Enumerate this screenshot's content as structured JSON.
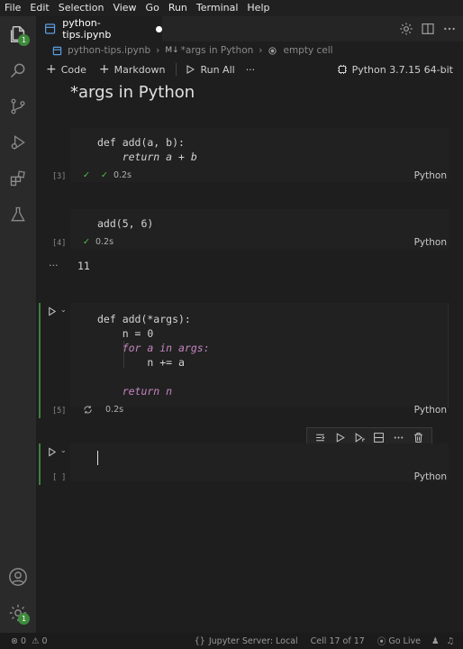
{
  "menu": [
    "File",
    "Edit",
    "Selection",
    "View",
    "Go",
    "Run",
    "Terminal",
    "Help"
  ],
  "tab": {
    "title": "python-tips.ipynb"
  },
  "breadcrumb": {
    "file": "python-tips.ipynb",
    "md_marker": "M↓",
    "section": "*args in Python",
    "cell": "empty cell"
  },
  "toolbar": {
    "code": "Code",
    "markdown": "Markdown",
    "run_all": "Run All",
    "more": "···",
    "kernel": "Python 3.7.15 64-bit"
  },
  "activity": {
    "explorer_badge": "1",
    "settings_badge": "1"
  },
  "heading": "*args in Python",
  "cells": [
    {
      "exec": "[3]",
      "time": "0.2s",
      "lang": "Python",
      "lines": [
        "def add(a, b):",
        "    return a + b"
      ]
    },
    {
      "exec": "[4]",
      "time": "0.2s",
      "lang": "Python",
      "lines": [
        "add(5, 6)"
      ],
      "output_more": "···",
      "output": "11"
    },
    {
      "exec": "[5]",
      "time": "0.2s",
      "lang": "Python",
      "lines": [
        "def add(*args):",
        "    n = 0",
        "    for a in args:",
        "        n += a",
        "",
        "    return n"
      ]
    },
    {
      "exec": "[ ]",
      "lang": "Python"
    }
  ],
  "statusbar": {
    "errors": "0",
    "warnings": "0",
    "jupyter": "Jupyter Server: Local",
    "cell": "Cell 17 of 17",
    "golive": "Go Live"
  },
  "colors": {
    "accent": "#3e7f3e",
    "badge": "#3d8a3b",
    "keyword": "#c586c0",
    "check": "#4ec94e"
  }
}
